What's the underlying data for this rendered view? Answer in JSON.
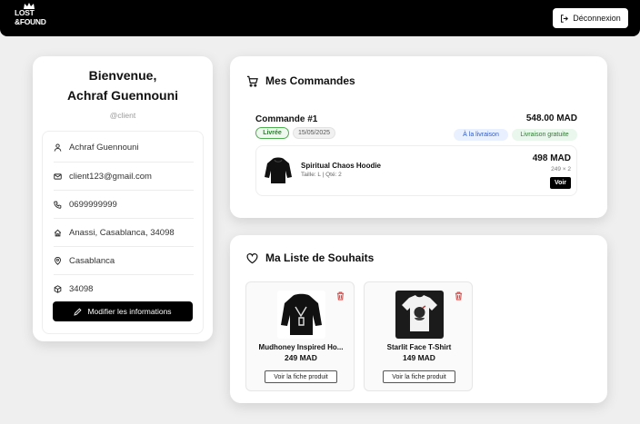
{
  "header": {
    "logo_text_top": "LOST",
    "logo_text_bottom": "&FOUND",
    "logout_label": "Déconnexion"
  },
  "profile": {
    "welcome_line1": "Bienvenue,",
    "welcome_line2": "Achraf Guennouni",
    "username": "@client",
    "fields": [
      {
        "icon": "user-icon",
        "value": "Achraf Guennouni"
      },
      {
        "icon": "mail-icon",
        "value": "client123@gmail.com"
      },
      {
        "icon": "phone-icon",
        "value": "0699999999"
      },
      {
        "icon": "home-icon",
        "value": "Anassi, Casablanca, 34098"
      },
      {
        "icon": "map-pin-icon",
        "value": "Casablanca"
      },
      {
        "icon": "box-icon",
        "value": "34098"
      }
    ],
    "edit_label": "Modifier les informations"
  },
  "orders": {
    "title": "Mes Commandes",
    "list": [
      {
        "title": "Commande #1",
        "total": "548.00 MAD",
        "status": "Livrée",
        "date": "15/05/2025",
        "payment": "À la livraison",
        "shipping": "Livraison gratuite",
        "items": [
          {
            "name": "Spiritual Chaos Hoodie",
            "meta": "Taille: L | Qté: 2",
            "price": "498 MAD",
            "unit": "249 × 2",
            "view_label": "Voir"
          }
        ]
      }
    ]
  },
  "wishlist": {
    "title": "Ma Liste de Souhaits",
    "items": [
      {
        "name": "Mudhoney Inspired Ho...",
        "price": "249 MAD",
        "button": "Voir la fiche produit"
      },
      {
        "name": "Starlit Face T-Shirt",
        "price": "149 MAD",
        "button": "Voir la fiche produit"
      }
    ]
  },
  "colors": {
    "topbar": "#000000",
    "accent_dark": "#000000",
    "status_green": "#2e7d32",
    "pay_blue": "#2f5bc7",
    "trash_red": "#e53935"
  }
}
